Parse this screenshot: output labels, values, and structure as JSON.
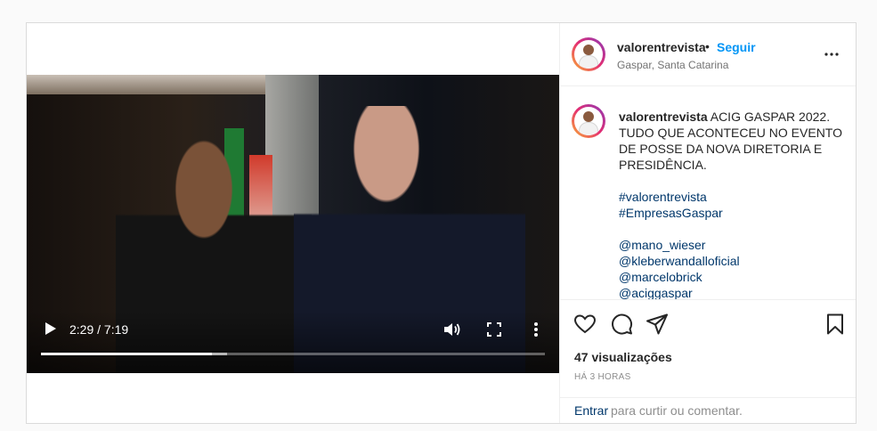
{
  "video": {
    "current_time": "2:29",
    "separator": " / ",
    "duration": "7:19",
    "progress": 0.34,
    "buffered": 0.37,
    "icons": [
      "play-icon",
      "volume-icon",
      "fullscreen-icon",
      "more-vertical-icon"
    ]
  },
  "post": {
    "username": "valorentrevista",
    "dot": "•",
    "follow_label": "Seguir",
    "location": "Gaspar, Santa Catarina",
    "more_icon": "more-horizontal-icon"
  },
  "caption": {
    "username": "valorentrevista",
    "text": "ACIG GASPAR 2022. TUDO QUE ACONTECEU NO EVENTO DE POSSE DA NOVA DIRETORIA E PRESIDÊNCIA.",
    "hashtags": [
      "#valorentrevista",
      "#EmpresasGaspar"
    ],
    "mentions": [
      "@mano_wieser",
      "@kleberwandalloficial",
      "@marcelobrick",
      "@aciggaspar"
    ]
  },
  "actions": {
    "icons": [
      "heart-icon",
      "comment-icon",
      "share-icon",
      "bookmark-icon"
    ],
    "views": "47 visualizações",
    "time_ago": "HÁ 3 HORAS"
  },
  "comment_box": {
    "login_label": "Entrar",
    "rest_text": "para curtir ou comentar."
  },
  "colors": {
    "link_blue": "#0095f6",
    "tag_blue": "#00376b",
    "muted": "#8e8e8e",
    "border": "#dbdbdb"
  }
}
